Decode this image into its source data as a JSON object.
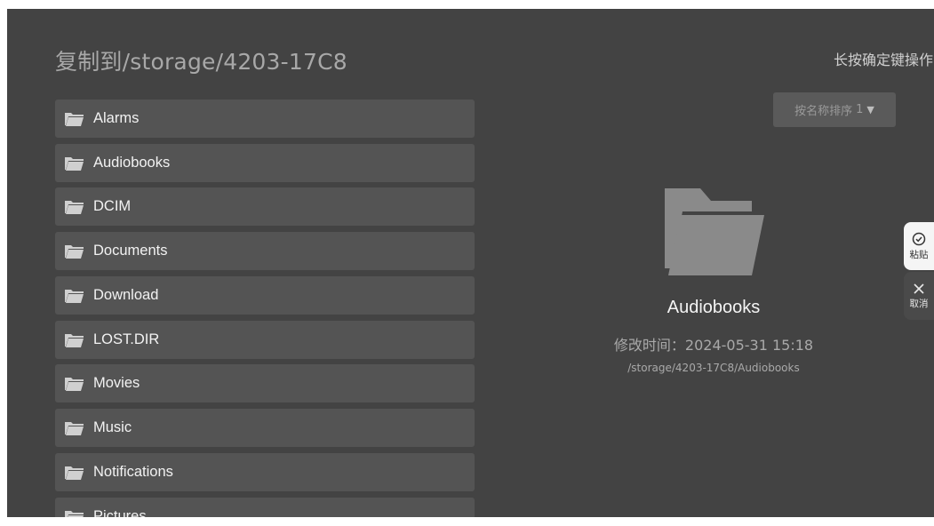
{
  "header": {
    "title": "复制到/storage/4203-17C8",
    "hint": "长按确定键操作"
  },
  "sort": {
    "label": "按名称排序",
    "arrow": "1",
    "caret": "▼"
  },
  "folders": [
    {
      "label": "Alarms"
    },
    {
      "label": "Audiobooks"
    },
    {
      "label": "DCIM"
    },
    {
      "label": "Documents"
    },
    {
      "label": "Download"
    },
    {
      "label": "LOST.DIR"
    },
    {
      "label": "Movies"
    },
    {
      "label": "Music"
    },
    {
      "label": "Notifications"
    },
    {
      "label": "Pictures"
    }
  ],
  "detail": {
    "name": "Audiobooks",
    "modified": "修改时间：2024-05-31 15:18",
    "path": "/storage/4203-17C8/Audiobooks"
  },
  "side": {
    "paste_label": "粘贴",
    "cancel_label": "取消"
  },
  "icons": {
    "folder": "folder-icon",
    "paste": "check-circle-icon",
    "cancel": "close-icon",
    "sort_caret": "caret-down-icon"
  }
}
